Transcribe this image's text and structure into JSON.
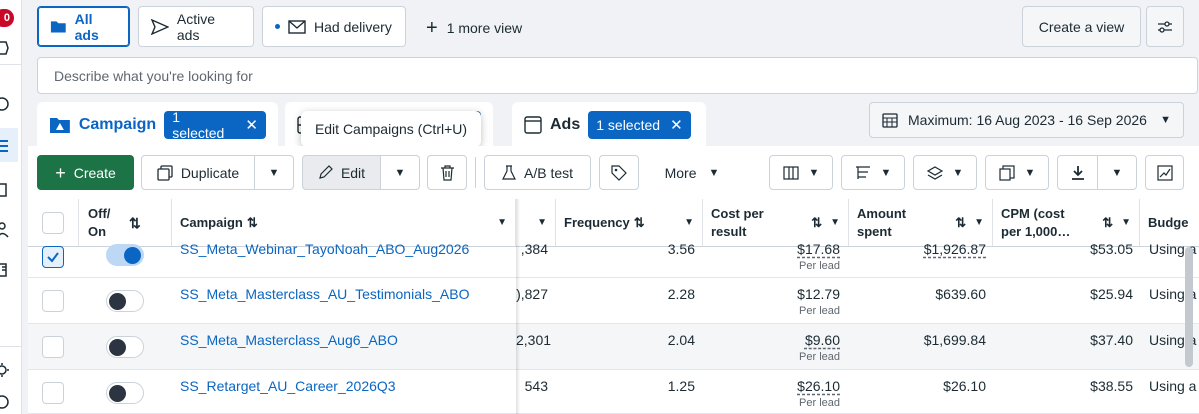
{
  "rail": {
    "badge": "0"
  },
  "views": {
    "all_ads": "All ads",
    "active_ads": "Active ads",
    "had_delivery": "Had delivery",
    "more_view": "1 more view",
    "create_view": "Create a view"
  },
  "search": {
    "placeholder": "Describe what you're looking for"
  },
  "level_tabs": {
    "campaigns_label": "Campaign",
    "campaigns_selected": "1 selected",
    "ads_label": "Ads",
    "ads_selected": "1 selected"
  },
  "tooltip": "Edit Campaigns (Ctrl+U)",
  "date_range": "Maximum: 16 Aug 2023 - 16 Sep 2026",
  "toolbar": {
    "create": "Create",
    "duplicate": "Duplicate",
    "edit": "Edit",
    "ab_test": "A/B test",
    "more": "More"
  },
  "columns": {
    "off_on_1": "Off/",
    "off_on_2": "On",
    "campaign": "Campaign",
    "frequency": "Frequency",
    "cost_1": "Cost per",
    "cost_2": "result",
    "amount_1": "Amount",
    "amount_2": "spent",
    "cpm_1": "CPM (cost",
    "cpm_2": "per 1,000…",
    "budget": "Budge"
  },
  "rows": [
    {
      "name": "SS_Meta_Webinar_TayoNoah_ABO_Aug2026",
      "results": ",384",
      "frequency": "3.56",
      "cost": "$17.68",
      "cost_sub": "Per lead",
      "amount": "$1,926.87",
      "cpm": "$53.05",
      "budget": "Using a",
      "checked": true,
      "on": true
    },
    {
      "name": "SS_Meta_Masterclass_AU_Testimonials_ABO",
      "results": "),827",
      "frequency": "2.28",
      "cost": "$12.79",
      "cost_sub": "Per lead",
      "amount": "$639.60",
      "cpm": "$25.94",
      "budget": "Using a",
      "checked": false,
      "on": false
    },
    {
      "name": "SS_Meta_Masterclass_Aug6_ABO",
      "results": "2,301",
      "frequency": "2.04",
      "cost": "$9.60",
      "cost_sub": "Per lead",
      "amount": "$1,699.84",
      "cpm": "$37.40",
      "budget": "Using a",
      "checked": false,
      "on": false
    },
    {
      "name": "SS_Retarget_AU_Career_2026Q3",
      "results": "543",
      "frequency": "1.25",
      "cost": "$26.10",
      "cost_sub": "Per lead",
      "amount": "$26.10",
      "cpm": "$38.55",
      "budget": "Using a",
      "checked": false,
      "on": false
    }
  ]
}
